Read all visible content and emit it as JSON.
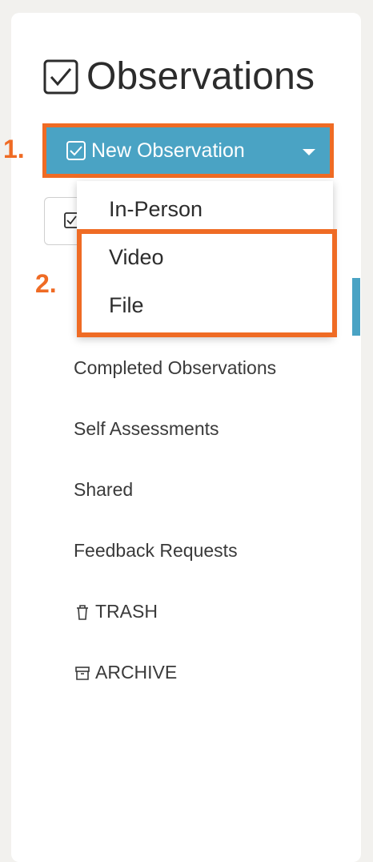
{
  "page": {
    "title": "Observations",
    "accent_color": "#4aa3c4",
    "highlight_color": "#ef6b24"
  },
  "new_observation": {
    "label": "New Observation",
    "icon": "checkbox-icon",
    "caret_icon": "caret-down-icon"
  },
  "steps": {
    "step1": "1.",
    "step2": "2."
  },
  "dropdown": {
    "items": [
      {
        "label": "In-Person"
      },
      {
        "label": "Video"
      },
      {
        "label": "File"
      }
    ]
  },
  "menu": {
    "items": [
      {
        "label": "Completed Observations"
      },
      {
        "label": "Self Assessments"
      },
      {
        "label": "Shared"
      },
      {
        "label": "Feedback Requests"
      },
      {
        "label": "TRASH",
        "icon": "trash-icon"
      },
      {
        "label": "ARCHIVE",
        "icon": "archive-icon"
      }
    ]
  }
}
